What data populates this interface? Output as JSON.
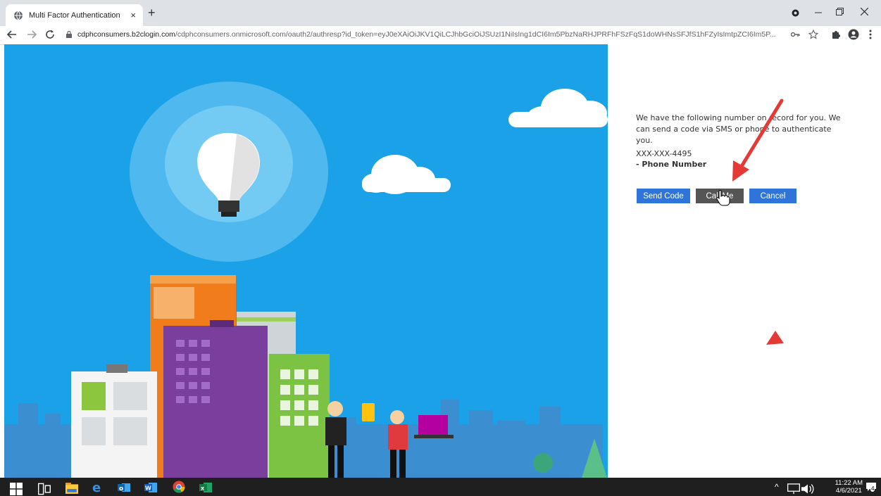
{
  "browser": {
    "tab_title": "Multi Factor Authentication",
    "tab_close": "×",
    "new_tab": "+",
    "url_host": "cdphconsumers.b2clogin.com",
    "url_rest": "/cdphconsumers.onmicrosoft.com/oauth2/authresp?id_token=eyJ0eXAiOiJKV1QiLCJhbGciOiJSUzI1NiIsIng1dCI6Im5PbzNaRHJPRFhFSzFqS1doWHNsSFJfS1hFZyIsImtpZCI6Im5P..."
  },
  "auth": {
    "intro": "We have the following number on record for you. We can send a code via SMS or phone to authenticate you.",
    "phone_number": "XXX-XXX-4495",
    "phone_label": "- Phone Number",
    "send_code_label": "Send Code",
    "call_me_label": "Call Me",
    "cancel_label": "Cancel"
  },
  "taskbar": {
    "time": "11:22 AM",
    "date": "4/6/2021",
    "notification_count": "4"
  },
  "colors": {
    "hero_bg": "#1aa1e8",
    "button_blue": "#2f74d9",
    "button_gray": "#555555",
    "annotation_arrow": "#e53935"
  },
  "icons": [
    "globe-icon",
    "back-icon",
    "forward-icon",
    "reload-icon",
    "lock-icon",
    "key-icon",
    "star-icon",
    "puzzle-icon",
    "account-icon",
    "menu-icon",
    "windows-start-icon",
    "task-view-icon",
    "file-explorer-icon",
    "edge-icon",
    "outlook-icon",
    "word-icon",
    "chrome-icon",
    "excel-icon",
    "network-icon",
    "volume-icon",
    "notification-icon"
  ]
}
